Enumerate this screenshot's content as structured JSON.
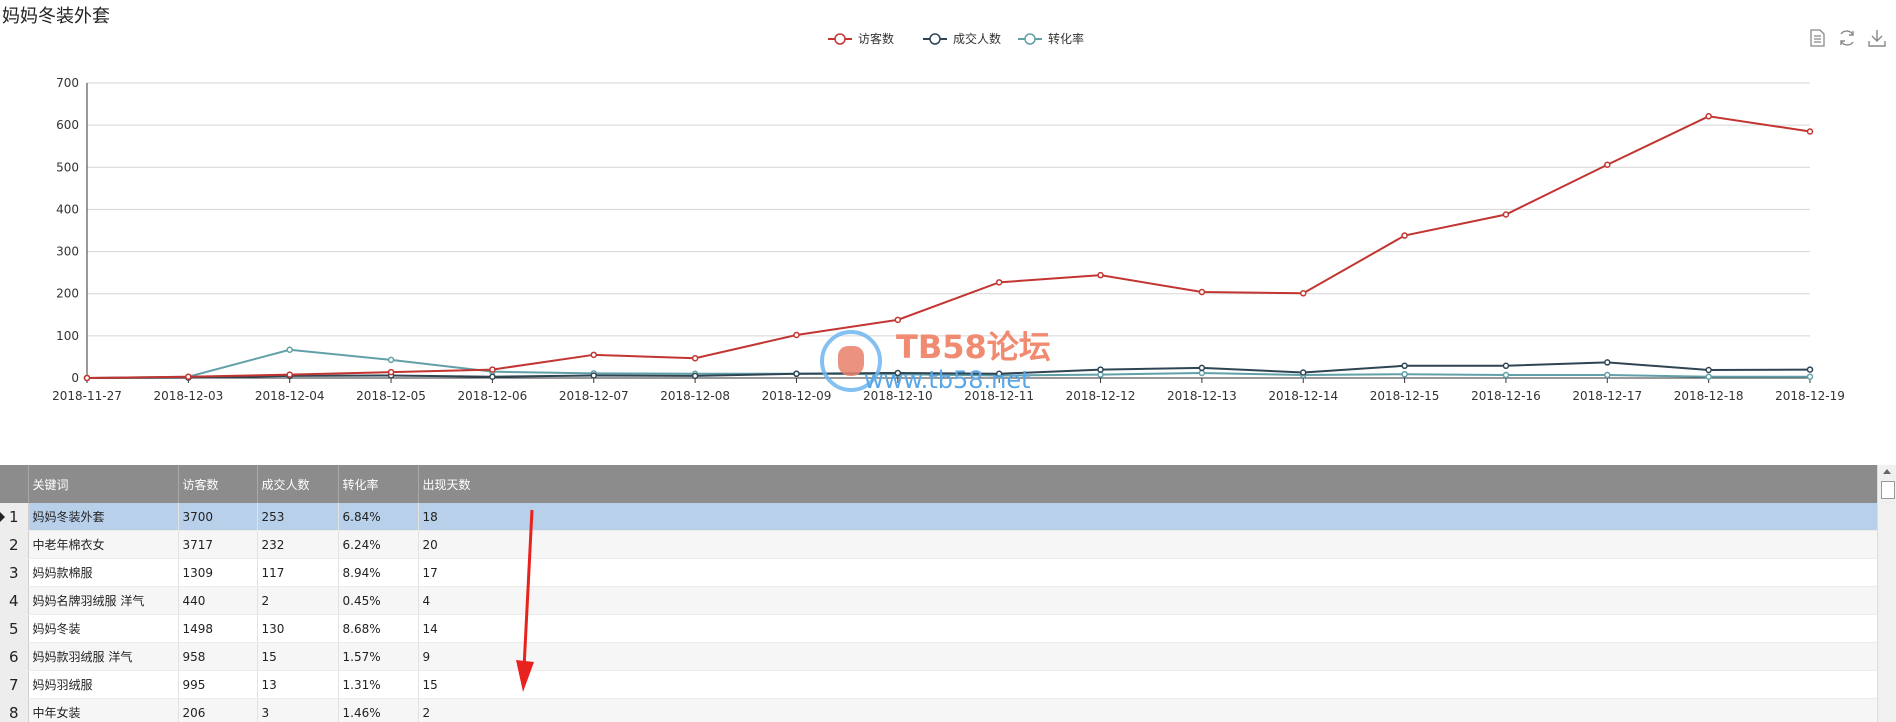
{
  "header": {
    "title": "妈妈冬装外套"
  },
  "toolbox": [
    {
      "name": "data-view-icon"
    },
    {
      "name": "restore-icon"
    },
    {
      "name": "save-image-icon"
    }
  ],
  "colors": {
    "visitors": "#c23531",
    "buyers": "#2f4554",
    "conversion": "#61a0a8",
    "header_bg": "#8c8c8c",
    "selected_bg": "#b8d0ea"
  },
  "chart_data": {
    "type": "line",
    "x": [
      "2018-11-27",
      "2018-12-03",
      "2018-12-04",
      "2018-12-05",
      "2018-12-06",
      "2018-12-07",
      "2018-12-08",
      "2018-12-09",
      "2018-12-10",
      "2018-12-11",
      "2018-12-12",
      "2018-12-13",
      "2018-12-14",
      "2018-12-15",
      "2018-12-16",
      "2018-12-17",
      "2018-12-18",
      "2018-12-19"
    ],
    "series": [
      {
        "name": "访客数",
        "color": "#c23531",
        "values": [
          0,
          3,
          8,
          14,
          20,
          55,
          47,
          102,
          138,
          227,
          244,
          204,
          201,
          338,
          388,
          506,
          621,
          585
        ]
      },
      {
        "name": "成交人数",
        "color": "#2f4554",
        "values": [
          0,
          1,
          5,
          6,
          3,
          6,
          5,
          10,
          12,
          10,
          20,
          24,
          13,
          29,
          29,
          37,
          19,
          20
        ]
      },
      {
        "name": "转化率",
        "color": "#61a0a8",
        "values": [
          0,
          3,
          67,
          43,
          15,
          11,
          10,
          10,
          9,
          6,
          8,
          12,
          7,
          9,
          7,
          7,
          3,
          3
        ]
      }
    ],
    "yticks": [
      "0",
      "100",
      "200",
      "300",
      "400",
      "500",
      "600",
      "700"
    ],
    "ylim": [
      0,
      700
    ],
    "grid": true,
    "legend_position": "top-center"
  },
  "table": {
    "columns": [
      "关键词",
      "访客数",
      "成交人数",
      "转化率",
      "出现天数"
    ],
    "rows": [
      {
        "num": "1",
        "cells": [
          "妈妈冬装外套",
          "3700",
          "253",
          "6.84%",
          "18"
        ]
      },
      {
        "num": "2",
        "cells": [
          "中老年棉衣女",
          "3717",
          "232",
          "6.24%",
          "20"
        ]
      },
      {
        "num": "3",
        "cells": [
          "妈妈款棉服",
          "1309",
          "117",
          "8.94%",
          "17"
        ]
      },
      {
        "num": "4",
        "cells": [
          "妈妈名牌羽绒服 洋气",
          "440",
          "2",
          "0.45%",
          "4"
        ]
      },
      {
        "num": "5",
        "cells": [
          "妈妈冬装",
          "1498",
          "130",
          "8.68%",
          "14"
        ]
      },
      {
        "num": "6",
        "cells": [
          "妈妈款羽绒服 洋气",
          "958",
          "15",
          "1.57%",
          "9"
        ]
      },
      {
        "num": "7",
        "cells": [
          "妈妈羽绒服",
          "995",
          "13",
          "1.31%",
          "15"
        ]
      },
      {
        "num": "8",
        "cells": [
          "中年女装",
          "206",
          "3",
          "1.46%",
          "2"
        ]
      }
    ],
    "selected_index": 0
  },
  "watermark": {
    "brand": "TB58论坛",
    "url": "www.tb58.net"
  }
}
